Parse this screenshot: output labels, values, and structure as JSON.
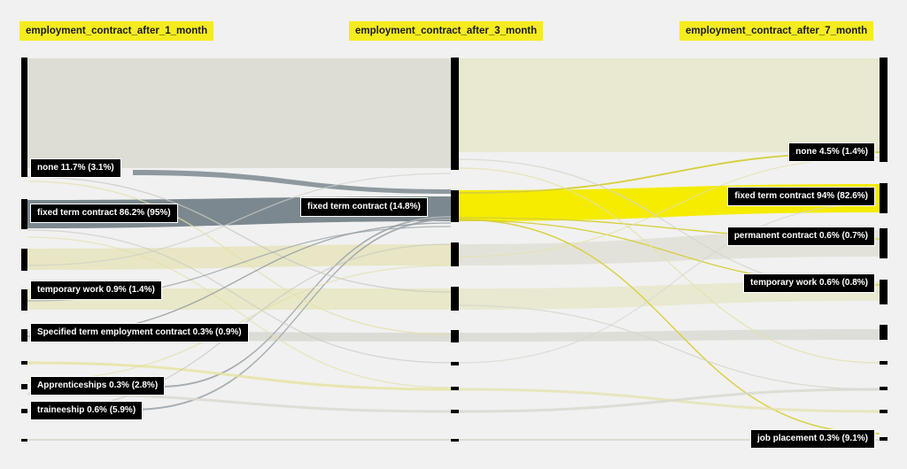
{
  "axes": [
    "employment_contract_after_1_month",
    "employment_contract_after_3_month",
    "employment_contract_after_7_month"
  ],
  "labels": {
    "m1_none": "none 11.7% (3.1%)",
    "m1_fixed": "fixed term contract 86.2% (95%)",
    "m1_temp": "temporary work 0.9% (1.4%)",
    "m1_specified": "Specified term employment contract 0.3% (0.9%)",
    "m1_apprentice": "Apprenticeships 0.3% (2.8%)",
    "m1_trainee": "traineeship 0.6% (5.9%)",
    "m3_fixed": "fixed term contract (14.8%)",
    "m7_none": "none 4.5% (1.4%)",
    "m7_fixed": "fixed term contract 94% (82.6%)",
    "m7_permanent": "permanent contract 0.6% (0.7%)",
    "m7_temp": "temporary work 0.6% (0.8%)",
    "m7_jobplacement": "job placement  0.3% (9.1%)"
  },
  "colors": {
    "background": "#f1f1f1",
    "node_bar": "#000000",
    "highlight": "#f5ec00",
    "axis_label_bg": "#f5ec1f",
    "flow_grey": "#d3d3cc",
    "flow_pale_yellow": "#e8e6b8",
    "flow_dark": "#6f7c84"
  }
}
